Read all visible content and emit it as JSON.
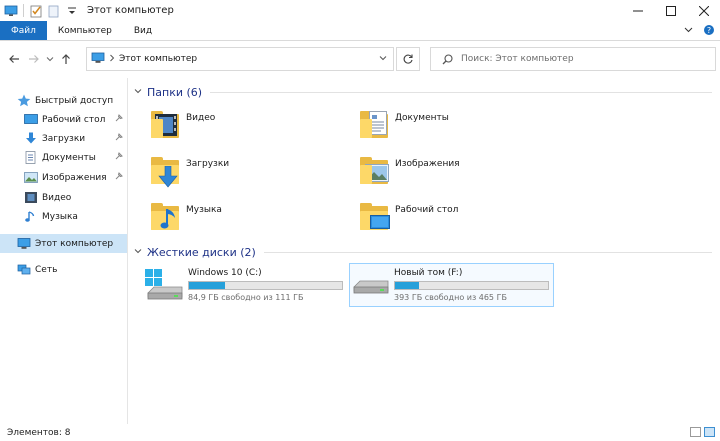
{
  "window": {
    "title": "Этот компьютер"
  },
  "ribbon": {
    "tabs": [
      {
        "label": "Файл",
        "active": true
      },
      {
        "label": "Компьютер",
        "active": false
      },
      {
        "label": "Вид",
        "active": false
      }
    ]
  },
  "address": {
    "path": "Этот компьютер",
    "search_placeholder": "Поиск: Этот компьютер"
  },
  "nav": {
    "items": [
      {
        "label": "Быстрый доступ",
        "icon": "star-icon",
        "pinned": false
      },
      {
        "label": "Рабочий стол",
        "icon": "desktop-icon",
        "pinned": true
      },
      {
        "label": "Загрузки",
        "icon": "download-icon",
        "pinned": true
      },
      {
        "label": "Документы",
        "icon": "documents-icon",
        "pinned": true
      },
      {
        "label": "Изображения",
        "icon": "pictures-icon",
        "pinned": true
      },
      {
        "label": "Видео",
        "icon": "video-icon",
        "pinned": false
      },
      {
        "label": "Музыка",
        "icon": "music-icon",
        "pinned": false
      },
      {
        "label": "Этот компьютер",
        "icon": "computer-icon",
        "pinned": false,
        "selected": true
      },
      {
        "label": "Сеть",
        "icon": "network-icon",
        "pinned": false
      }
    ]
  },
  "folders_group": {
    "header": "Папки (6)",
    "items": [
      {
        "label": "Видео",
        "icon": "video-folder-icon"
      },
      {
        "label": "Документы",
        "icon": "documents-folder-icon"
      },
      {
        "label": "Загрузки",
        "icon": "downloads-folder-icon"
      },
      {
        "label": "Изображения",
        "icon": "pictures-folder-icon"
      },
      {
        "label": "Музыка",
        "icon": "music-folder-icon"
      },
      {
        "label": "Рабочий стол",
        "icon": "desktop-folder-icon"
      }
    ]
  },
  "drives_group": {
    "header": "Жесткие диски (2)",
    "items": [
      {
        "label": "Windows 10 (C:)",
        "free_text": "84,9 ГБ свободно из 111 ГБ",
        "used_fraction": 0.235,
        "icon": "system-drive-icon"
      },
      {
        "label": "Новый том (F:)",
        "free_text": "393 ГБ свободно из 465 ГБ",
        "used_fraction": 0.155,
        "icon": "drive-icon",
        "selected": true
      }
    ]
  },
  "status": {
    "count_text": "Элементов: 8"
  },
  "colors": {
    "accent": "#1a6fc2",
    "selection": "#cce4f7",
    "progress": "#26a0da",
    "group_header": "#1e3287"
  }
}
